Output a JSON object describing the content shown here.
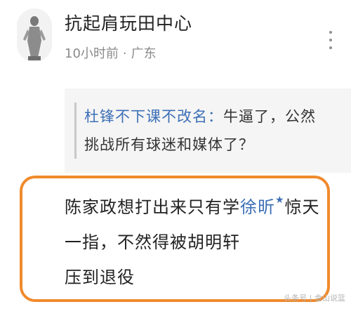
{
  "post": {
    "username": "抗起肩玩田中心",
    "time": "10小时前",
    "separator": "·",
    "location": "广东"
  },
  "quoted": {
    "author": "杜锋不下课不改名：",
    "text_line1": "牛逼了，公然",
    "text_line2": "挑战所有球迷和媒体了？"
  },
  "reply": {
    "line1_pre": "陈家政想打出来只有学",
    "mention": "徐昕",
    "line1_post": "惊天",
    "line2": "一指，不然得被胡明轩",
    "line3": "压到退役"
  },
  "watermark": "头条号 | 金山说篮",
  "colors": {
    "highlight_border": "#f08a2c",
    "link_blue": "#3d6fb6"
  },
  "icons": {
    "more": "vertical-dots-icon",
    "avatar": "statue-avatar",
    "verified": "star-badge-icon"
  }
}
